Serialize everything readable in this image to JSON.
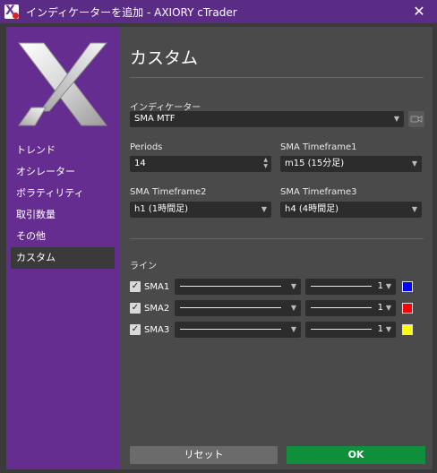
{
  "window": {
    "title": "インディケーターを追加 - AXIORY cTrader",
    "close_glyph": "✕"
  },
  "sidebar": {
    "items": [
      {
        "label": "トレンド",
        "active": false
      },
      {
        "label": "オシレーター",
        "active": false
      },
      {
        "label": "ボラティリティ",
        "active": false
      },
      {
        "label": "取引数量",
        "active": false
      },
      {
        "label": "その他",
        "active": false
      },
      {
        "label": "カスタム",
        "active": true
      }
    ]
  },
  "main": {
    "title": "カスタム",
    "indicator": {
      "label": "インディケーター",
      "value": "SMA MTF"
    },
    "periods": {
      "label": "Periods",
      "value": "14"
    },
    "tf1": {
      "label": "SMA Timeframe1",
      "value": "m15 (15分足)"
    },
    "tf2": {
      "label": "SMA Timeframe2",
      "value": "h1 (1時間足)"
    },
    "tf3": {
      "label": "SMA Timeframe3",
      "value": "h4 (4時間足)"
    },
    "lines_label": "ライン",
    "lines": [
      {
        "name": "SMA1",
        "checked": true,
        "width": "1",
        "color": "#0000ff"
      },
      {
        "name": "SMA2",
        "checked": true,
        "width": "1",
        "color": "#ff0000"
      },
      {
        "name": "SMA3",
        "checked": true,
        "width": "1",
        "color": "#ffff00"
      }
    ]
  },
  "footer": {
    "reset_label": "リセット",
    "ok_label": "OK"
  },
  "colors": {
    "brand_purple": "#662d91",
    "ok_green": "#0f8f3c"
  },
  "icons": {
    "check": "✓",
    "caret": "▼"
  }
}
